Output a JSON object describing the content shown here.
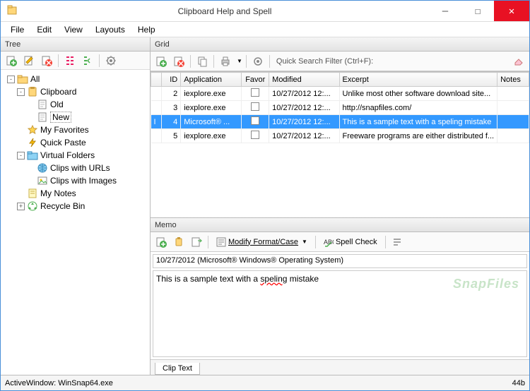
{
  "title": "Clipboard Help and Spell",
  "menus": [
    "File",
    "Edit",
    "View",
    "Layouts",
    "Help"
  ],
  "panels": {
    "tree": "Tree",
    "grid": "Grid",
    "memo": "Memo"
  },
  "tree": [
    {
      "level": 0,
      "expander": "-",
      "icon": "folder",
      "label": "All"
    },
    {
      "level": 1,
      "expander": "-",
      "icon": "clipboard",
      "label": "Clipboard"
    },
    {
      "level": 2,
      "expander": "",
      "icon": "doc",
      "label": "Old"
    },
    {
      "level": 2,
      "expander": "",
      "icon": "doc",
      "label": "New",
      "selected": true
    },
    {
      "level": 1,
      "expander": "",
      "icon": "star",
      "label": "My Favorites"
    },
    {
      "level": 1,
      "expander": "",
      "icon": "flash",
      "label": "Quick Paste"
    },
    {
      "level": 1,
      "expander": "-",
      "icon": "vfolder",
      "label": "Virtual Folders"
    },
    {
      "level": 2,
      "expander": "",
      "icon": "globe",
      "label": "Clips with URLs"
    },
    {
      "level": 2,
      "expander": "",
      "icon": "image",
      "label": "Clips with Images"
    },
    {
      "level": 1,
      "expander": "",
      "icon": "note",
      "label": "My Notes"
    },
    {
      "level": 1,
      "expander": "+",
      "icon": "recycle",
      "label": "Recycle Bin"
    }
  ],
  "quick_search": {
    "label": "Quick Search Filter (Ctrl+F):",
    "value": ""
  },
  "columns": [
    "",
    "ID",
    "Application",
    "Favor",
    "Modified",
    "Excerpt",
    "Notes"
  ],
  "rows": [
    {
      "id": "2",
      "app": "iexplore.exe",
      "fav": false,
      "mod": "10/27/2012 12:...",
      "exc": "Unlike most other software download site...",
      "notes": "",
      "selected": false
    },
    {
      "id": "3",
      "app": "iexplore.exe",
      "fav": false,
      "mod": "10/27/2012 12:...",
      "exc": "http://snapfiles.com/",
      "notes": "",
      "selected": false
    },
    {
      "id": "4",
      "app": "Microsoft® ...",
      "fav": true,
      "mod": "10/27/2012 12:...",
      "exc": "This is a sample text with a speling mistake",
      "notes": "",
      "selected": true
    },
    {
      "id": "5",
      "app": "iexplore.exe",
      "fav": false,
      "mod": "10/27/2012 12:...",
      "exc": "Freeware programs are either distributed f...",
      "notes": "",
      "selected": false
    }
  ],
  "memo_toolbar": {
    "modify": "Modify Format/Case",
    "spell": "Spell Check"
  },
  "memo": {
    "title": "10/27/2012 (Microsoft® Windows® Operating System)",
    "body_pre": "This is a sample text with a ",
    "body_err": "speling",
    "body_post": " mistake",
    "watermark": "SnapFiles"
  },
  "tab": "Clip Text",
  "status": {
    "left": "ActiveWindow: WinSnap64.exe",
    "right": "44b"
  }
}
